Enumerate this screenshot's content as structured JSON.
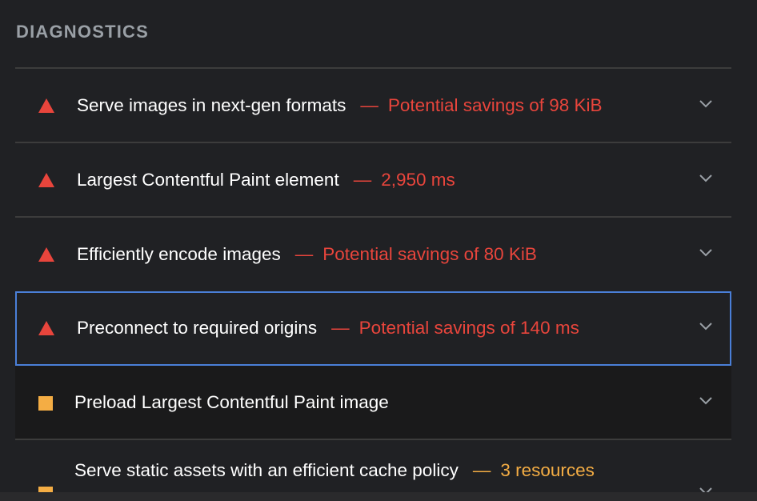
{
  "section": {
    "title": "DIAGNOSTICS"
  },
  "audits": [
    {
      "title": "Serve images in next-gen formats",
      "dash": "—",
      "detail": "Potential savings of 98 KiB",
      "status": "fail",
      "icon": "fail-triangle-icon"
    },
    {
      "title": "Largest Contentful Paint element",
      "dash": "—",
      "detail": "2,950 ms",
      "status": "fail",
      "icon": "fail-triangle-icon"
    },
    {
      "title": "Efficiently encode images",
      "dash": "—",
      "detail": "Potential savings of 80 KiB",
      "status": "fail",
      "icon": "fail-triangle-icon"
    },
    {
      "title": "Preconnect to required origins",
      "dash": "—",
      "detail": "Potential savings of 140 ms",
      "status": "fail",
      "icon": "fail-triangle-icon"
    },
    {
      "title": "Preload Largest Contentful Paint image",
      "status": "average",
      "icon": "average-square-icon"
    },
    {
      "title": "Serve static assets with an efficient cache policy",
      "dash": "—",
      "detail": "3 resources",
      "status": "average",
      "icon": "average-square-icon"
    }
  ],
  "colors": {
    "background": "#202124",
    "fail": "#e8453c",
    "average": "#f4ad44",
    "focus_border": "#4a7fd8",
    "divider": "#3c3c3c",
    "title_gray": "#9aa0a6"
  }
}
